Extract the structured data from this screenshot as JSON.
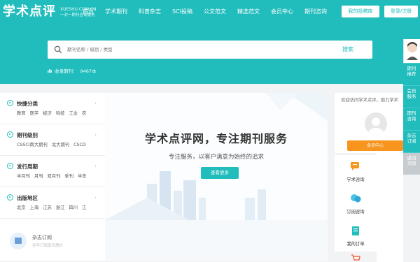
{
  "header": {
    "logo": "学术点评",
    "domain": "XUESHU.COM.CN",
    "slogan": "一对一期刊咨询服务",
    "nav": [
      "首页",
      "学术期刊",
      "科普杂志",
      "SCI投稿",
      "公文范文",
      "精选范文",
      "会员中心",
      "期刊咨询"
    ],
    "contribute_label": "我的投稿库",
    "login_label": "登录/注册"
  },
  "search": {
    "placeholder": "期刊名称 / 级别 / 类型",
    "button_label": "搜索"
  },
  "stats": {
    "label": "收录期刊：",
    "value": "9467本"
  },
  "float_bar": {
    "items": [
      "期刊推荐",
      "会员服务",
      "期刊咨询",
      "杂志订阅",
      "返回顶部"
    ]
  },
  "categories": [
    {
      "title": "快捷分类",
      "links": [
        "教育",
        "医学",
        "经济",
        "科技",
        "工业",
        "农"
      ]
    },
    {
      "title": "期刊级别",
      "links": [
        "CSSCI南大期刊",
        "北大期刊",
        "CSCD"
      ]
    },
    {
      "title": "发行周期",
      "links": [
        "半月刊",
        "月刊",
        "双月刊",
        "季刊",
        "半年"
      ]
    },
    {
      "title": "出版地区",
      "links": [
        "北京",
        "上海",
        "江苏",
        "浙江",
        "四川",
        "江"
      ]
    }
  ],
  "order": {
    "title": "杂志订阅",
    "subtitle": "全年订阅享优惠价"
  },
  "banner": {
    "title": "学术点评网，专注期刊服务",
    "subtitle": "专注服务，以客户满意为始终的追求",
    "button_label": "查看更多"
  },
  "user": {
    "welcome": "欢迎访问学术点评，助力学术",
    "member_button": "会员中心"
  },
  "services": [
    {
      "label": "学术咨询",
      "icon": "chat-icon"
    },
    {
      "label": "订阅咨询",
      "icon": "message-icon"
    },
    {
      "label": "我的订单",
      "icon": "order-icon"
    }
  ],
  "colors": {
    "brand": "#21bcbc",
    "accent_orange": "#f7951e"
  }
}
